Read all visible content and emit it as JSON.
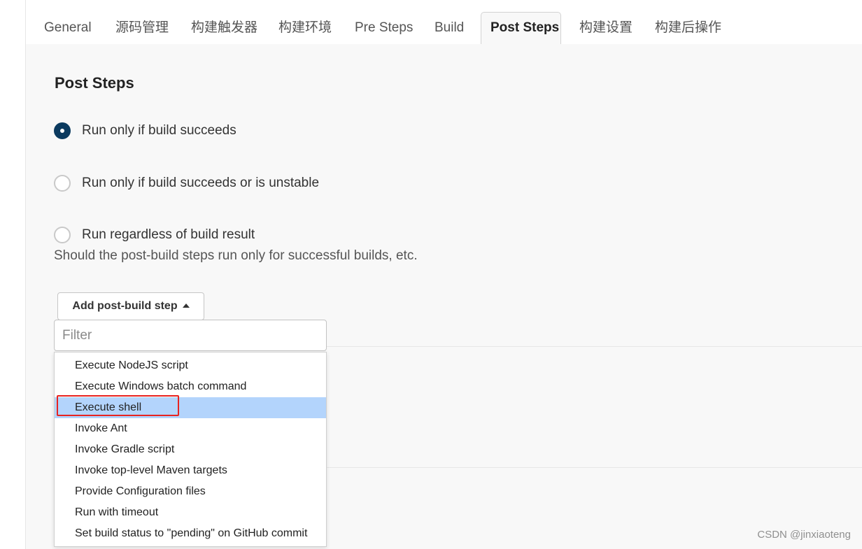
{
  "tabs": [
    {
      "label": "General"
    },
    {
      "label": "源码管理"
    },
    {
      "label": "构建触发器"
    },
    {
      "label": "构建环境"
    },
    {
      "label": "Pre Steps"
    },
    {
      "label": "Build"
    },
    {
      "label": "Post Steps"
    },
    {
      "label": "构建设置"
    },
    {
      "label": "构建后操作"
    }
  ],
  "active_tab": "Post Steps",
  "section": {
    "title": "Post Steps"
  },
  "radios": [
    {
      "label": "Run only if build succeeds",
      "checked": true
    },
    {
      "label": "Run only if build succeeds or is unstable",
      "checked": false
    },
    {
      "label": "Run regardless of build result",
      "checked": false
    }
  ],
  "help_text": "Should the post-build steps run only for successful builds, etc.",
  "add_button": {
    "label": "Add post-build step",
    "icon": "caret-up-icon"
  },
  "filter": {
    "placeholder": "Filter",
    "value": ""
  },
  "dropdown": {
    "items": [
      {
        "label": "Execute NodeJS script"
      },
      {
        "label": "Execute Windows batch command"
      },
      {
        "label": "Execute shell",
        "highlighted": true
      },
      {
        "label": "Invoke Ant"
      },
      {
        "label": "Invoke Gradle script"
      },
      {
        "label": "Invoke top-level Maven targets"
      },
      {
        "label": "Provide Configuration files"
      },
      {
        "label": "Run with timeout"
      },
      {
        "label": "Set build status to \"pending\" on GitHub commit"
      }
    ]
  },
  "colors": {
    "radio_checked": "#0b3a5f",
    "highlight": "#b3d4fc",
    "annotation": "#e8231f",
    "content_bg": "#f8f8f8"
  },
  "watermark": "CSDN @jinxiaoteng"
}
